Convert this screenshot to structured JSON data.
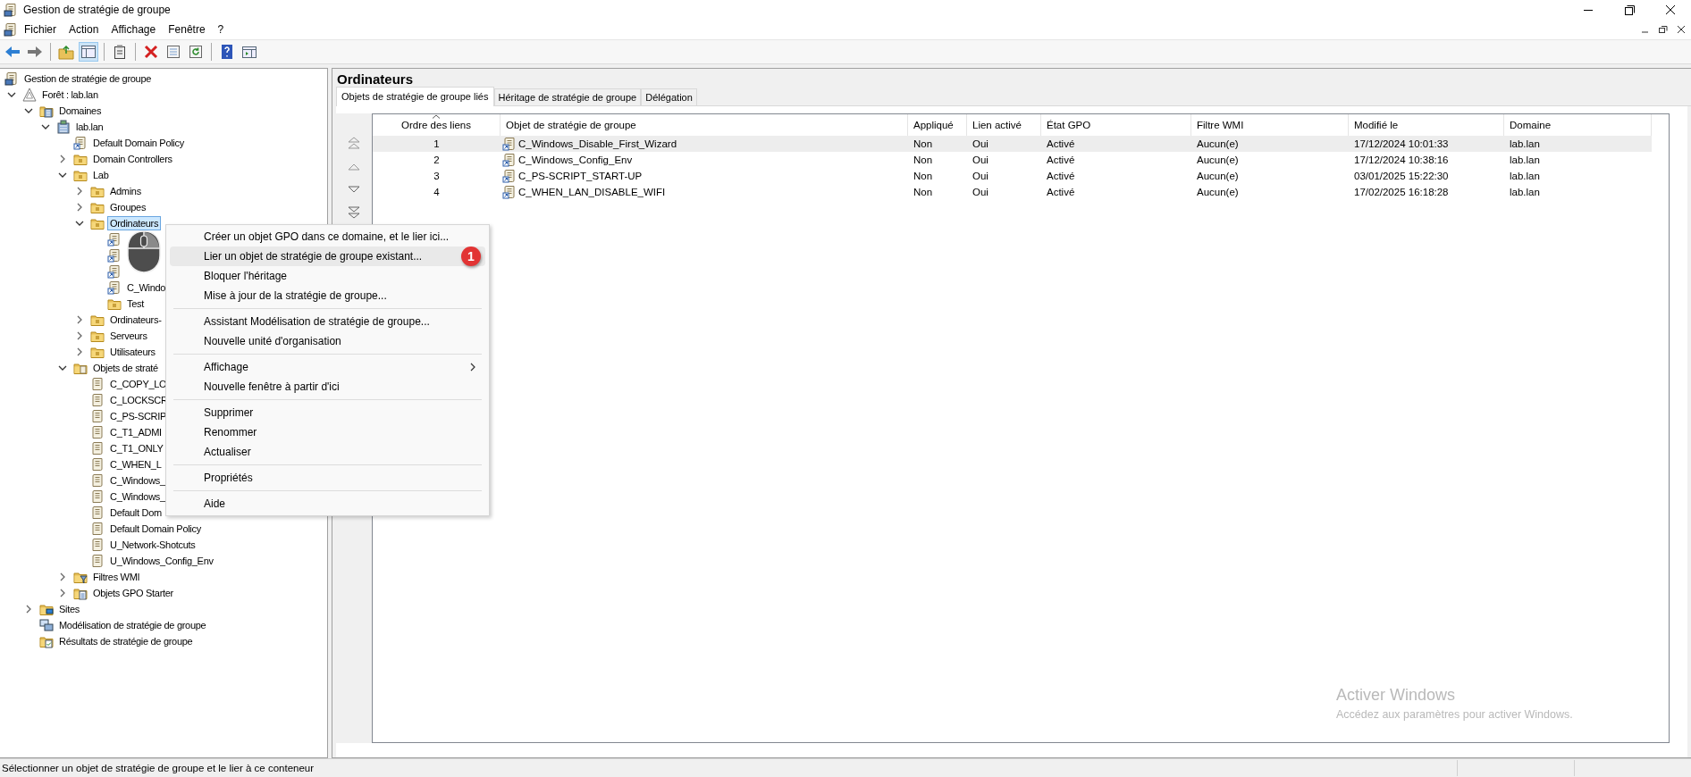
{
  "window": {
    "title": "Gestion de stratégie de groupe"
  },
  "menu_bar": [
    "Fichier",
    "Action",
    "Affichage",
    "Fenêtre",
    "?"
  ],
  "tree": [
    {
      "label": "Gestion de stratégie de groupe",
      "kind": "console",
      "selected": false,
      "children": [
        {
          "label": "Forêt : lab.lan",
          "kind": "forest",
          "expanded": true,
          "selected": false,
          "children": [
            {
              "label": "Domaines",
              "kind": "domains",
              "expanded": true,
              "selected": false,
              "children": [
                {
                  "label": "lab.lan",
                  "kind": "domain",
                  "expanded": true,
                  "selected": false,
                  "children": [
                    {
                      "label": "Default Domain Policy",
                      "kind": "link",
                      "selected": false
                    },
                    {
                      "label": "Domain Controllers",
                      "kind": "ou",
                      "expanded": false,
                      "selected": false
                    },
                    {
                      "label": "Lab",
                      "kind": "ou",
                      "expanded": true,
                      "selected": false,
                      "children": [
                        {
                          "label": "Admins",
                          "kind": "ou",
                          "expanded": false,
                          "selected": false
                        },
                        {
                          "label": "Groupes",
                          "kind": "ou",
                          "expanded": false,
                          "selected": false
                        },
                        {
                          "label": "Ordinateurs",
                          "kind": "ou",
                          "expanded": true,
                          "selected": true,
                          "children": [
                            {
                              "kind": "link"
                            },
                            {
                              "kind": "link"
                            },
                            {
                              "kind": "link"
                            },
                            {
                              "label": "C_Windo",
                              "kind": "link",
                              "selected": false
                            },
                            {
                              "label": "Test",
                              "kind": "ou",
                              "selected": false
                            }
                          ]
                        },
                        {
                          "label": "Ordinateurs-",
                          "kind": "ou",
                          "expanded": false,
                          "selected": false
                        },
                        {
                          "label": "Serveurs",
                          "kind": "ou",
                          "expanded": false,
                          "selected": false
                        },
                        {
                          "label": "Utilisateurs",
                          "kind": "ou",
                          "expanded": false,
                          "selected": false
                        }
                      ]
                    },
                    {
                      "label": "Objets de straté",
                      "kind": "gpos",
                      "expanded": true,
                      "selected": false,
                      "children": [
                        {
                          "label": "C_COPY_LO",
                          "kind": "gpo",
                          "selected": false
                        },
                        {
                          "label": "C_LOCKSCR",
                          "kind": "gpo",
                          "selected": false
                        },
                        {
                          "label": "C_PS-SCRIP",
                          "kind": "gpo",
                          "selected": false
                        },
                        {
                          "label": "C_T1_ADMI",
                          "kind": "gpo",
                          "selected": false
                        },
                        {
                          "label": "C_T1_ONLY",
                          "kind": "gpo",
                          "selected": false
                        },
                        {
                          "label": "C_WHEN_L",
                          "kind": "gpo",
                          "selected": false
                        },
                        {
                          "label": "C_Windows_",
                          "kind": "gpo",
                          "selected": false
                        },
                        {
                          "label": "C_Windows_",
                          "kind": "gpo",
                          "selected": false
                        },
                        {
                          "label": "Default Dom",
                          "kind": "gpo",
                          "selected": false
                        },
                        {
                          "label": "Default Domain Policy",
                          "kind": "gpo",
                          "selected": false
                        },
                        {
                          "label": "U_Network-Shotcuts",
                          "kind": "gpo",
                          "selected": false
                        },
                        {
                          "label": "U_Windows_Config_Env",
                          "kind": "gpo",
                          "selected": false
                        }
                      ]
                    },
                    {
                      "label": "Filtres WMI",
                      "kind": "filter",
                      "expanded": false,
                      "selected": false
                    },
                    {
                      "label": "Objets GPO Starter",
                      "kind": "starter",
                      "expanded": false,
                      "selected": false
                    }
                  ]
                }
              ]
            },
            {
              "label": "Sites",
              "kind": "sites",
              "expanded": false,
              "selected": false
            },
            {
              "label": "Modélisation de stratégie de groupe",
              "kind": "modeling",
              "selected": false
            },
            {
              "label": "Résultats de stratégie de groupe",
              "kind": "results",
              "selected": false
            }
          ]
        }
      ]
    }
  ],
  "details": {
    "title": "Ordinateurs",
    "tabs": [
      {
        "label": "Objets de stratégie de groupe liés",
        "selected": true
      },
      {
        "label": "Héritage de stratégie de groupe",
        "selected": false
      },
      {
        "label": "Délégation",
        "selected": false
      }
    ],
    "columns": [
      {
        "label": "Ordre des liens",
        "sorted": true
      },
      {
        "label": "Objet de stratégie de groupe",
        "sorted": false
      },
      {
        "label": "Appliqué",
        "sorted": false
      },
      {
        "label": "Lien activé",
        "sorted": false
      },
      {
        "label": "État GPO",
        "sorted": false
      },
      {
        "label": "Filtre WMI",
        "sorted": false
      },
      {
        "label": "Modifié le",
        "sorted": false
      },
      {
        "label": "Domaine",
        "sorted": false
      }
    ],
    "rows": [
      {
        "selected": true,
        "cells": [
          "1",
          "C_Windows_Disable_First_Wizard",
          "Non",
          "Oui",
          "Activé",
          "Aucun(e)",
          "17/12/2024 10:01:33",
          "lab.lan"
        ]
      },
      {
        "selected": false,
        "cells": [
          "2",
          "C_Windows_Config_Env",
          "Non",
          "Oui",
          "Activé",
          "Aucun(e)",
          "17/12/2024 10:38:16",
          "lab.lan"
        ]
      },
      {
        "selected": false,
        "cells": [
          "3",
          "C_PS-SCRIPT_START-UP",
          "Non",
          "Oui",
          "Activé",
          "Aucun(e)",
          "03/01/2025 15:22:30",
          "lab.lan"
        ]
      },
      {
        "selected": false,
        "cells": [
          "4",
          "C_WHEN_LAN_DISABLE_WIFI",
          "Non",
          "Oui",
          "Activé",
          "Aucun(e)",
          "17/02/2025 16:18:28",
          "lab.lan"
        ]
      }
    ]
  },
  "context_menu": {
    "groups": [
      [
        {
          "label": "Créer un objet GPO dans ce domaine, et le lier ici...",
          "highlighted": false,
          "submenu": false
        },
        {
          "label": "Lier un objet de stratégie de groupe existant...",
          "highlighted": true,
          "submenu": false
        },
        {
          "label": "Bloquer l'héritage",
          "highlighted": false,
          "submenu": false
        },
        {
          "label": "Mise à jour de la stratégie de groupe...",
          "highlighted": false,
          "submenu": false
        }
      ],
      [
        {
          "label": "Assistant Modélisation de stratégie de groupe...",
          "highlighted": false,
          "submenu": false
        },
        {
          "label": "Nouvelle unité d'organisation",
          "highlighted": false,
          "submenu": false
        }
      ],
      [
        {
          "label": "Affichage",
          "highlighted": false,
          "submenu": true
        },
        {
          "label": "Nouvelle fenêtre à partir d'ici",
          "highlighted": false,
          "submenu": false
        }
      ],
      [
        {
          "label": "Supprimer",
          "highlighted": false,
          "submenu": false
        },
        {
          "label": "Renommer",
          "highlighted": false,
          "submenu": false
        },
        {
          "label": "Actualiser",
          "highlighted": false,
          "submenu": false
        }
      ],
      [
        {
          "label": "Propriétés",
          "highlighted": false,
          "submenu": false
        }
      ],
      [
        {
          "label": "Aide",
          "highlighted": false,
          "submenu": false
        }
      ]
    ]
  },
  "annotation": {
    "label": "1"
  },
  "activation_notice": {
    "title": "Activer Windows",
    "text": "Accédez aux paramètres pour activer Windows."
  },
  "status_bar": "Sélectionner un objet de stratégie de groupe et le lier à ce conteneur"
}
